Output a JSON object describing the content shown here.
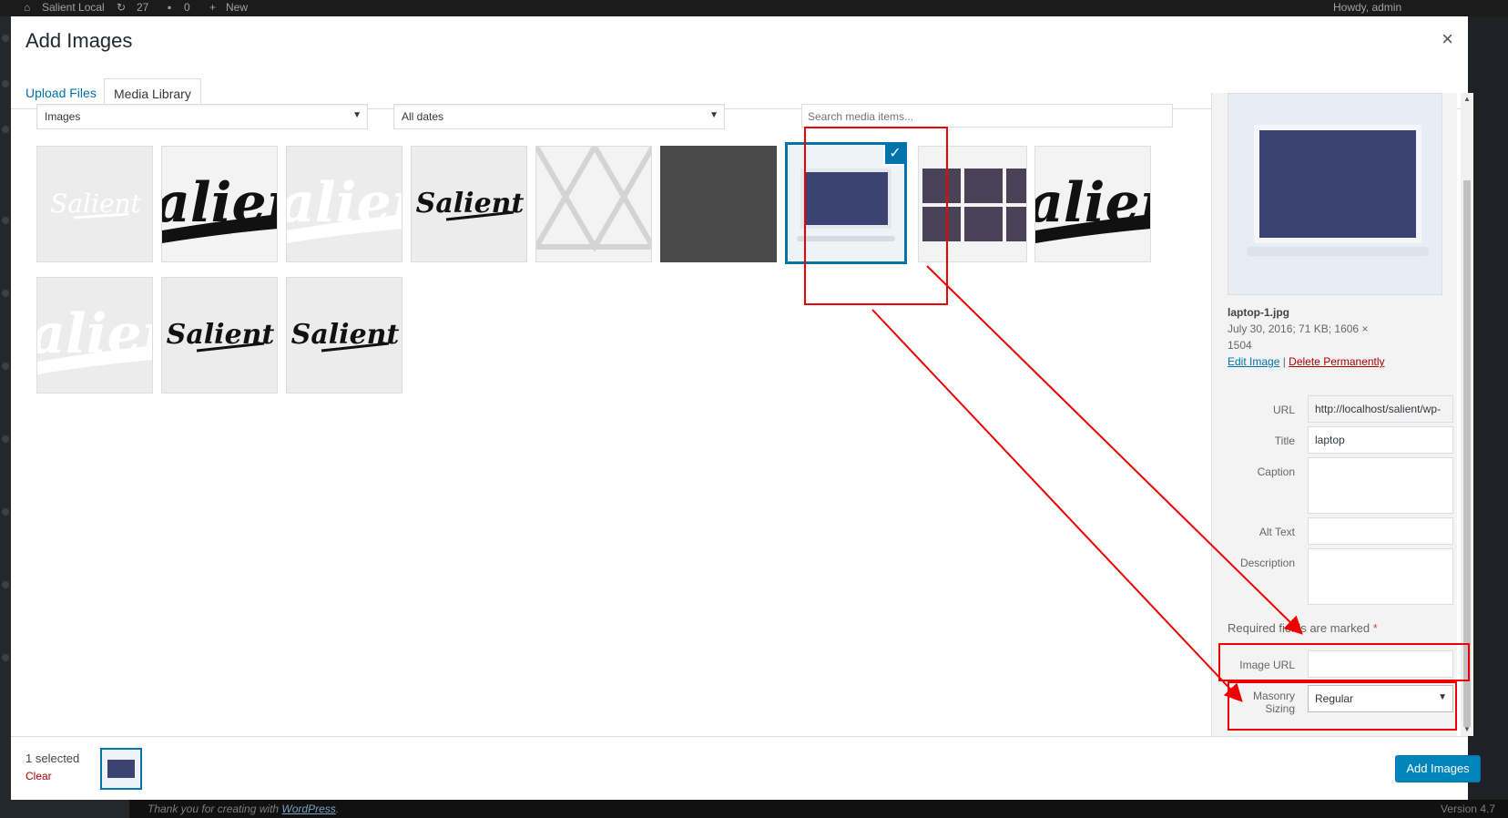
{
  "adminbar": {
    "site_name": "Salient Local",
    "updates_count": "27",
    "comments_count": "0",
    "new_label": "New",
    "howdy": "Howdy, admin"
  },
  "modal": {
    "title": "Add Images",
    "close_glyph": "×",
    "tabs": [
      "Upload Files",
      "Media Library"
    ]
  },
  "filters": {
    "type": "Images",
    "dates": "All dates",
    "search_placeholder": "Search media items..."
  },
  "attachment": {
    "filename": "laptop-1.jpg",
    "date_size": "July 30, 2016;  71 KB;  1606 ×",
    "height": "1504",
    "edit_link": "Edit Image",
    "separator": " | ",
    "delete_link": "Delete Permanently",
    "fields": {
      "url_label": "URL",
      "url_value": "http://localhost/salient/wp-",
      "title_label": "Title",
      "title_value": "laptop",
      "caption_label": "Caption",
      "alt_label": "Alt Text",
      "description_label": "Description",
      "required_note": "Required fields are marked",
      "required_star": "*",
      "image_url_label": "Image URL",
      "masonry_label_1": "Masonry",
      "masonry_label_2": "Sizing",
      "masonry_value": "Regular"
    }
  },
  "bottombar": {
    "selected_text": "1 selected",
    "clear_label": "Clear",
    "add_button": "Add Images"
  },
  "footer": {
    "thanks_prefix": "Thank you for creating with",
    "thanks_link": "WordPress",
    "thanks_suffix": ".",
    "version": "Version 4.7"
  },
  "colors": {
    "accent": "#0073aa",
    "primary_button": "#0085ba",
    "danger": "#a00",
    "annotation": "#e00"
  }
}
